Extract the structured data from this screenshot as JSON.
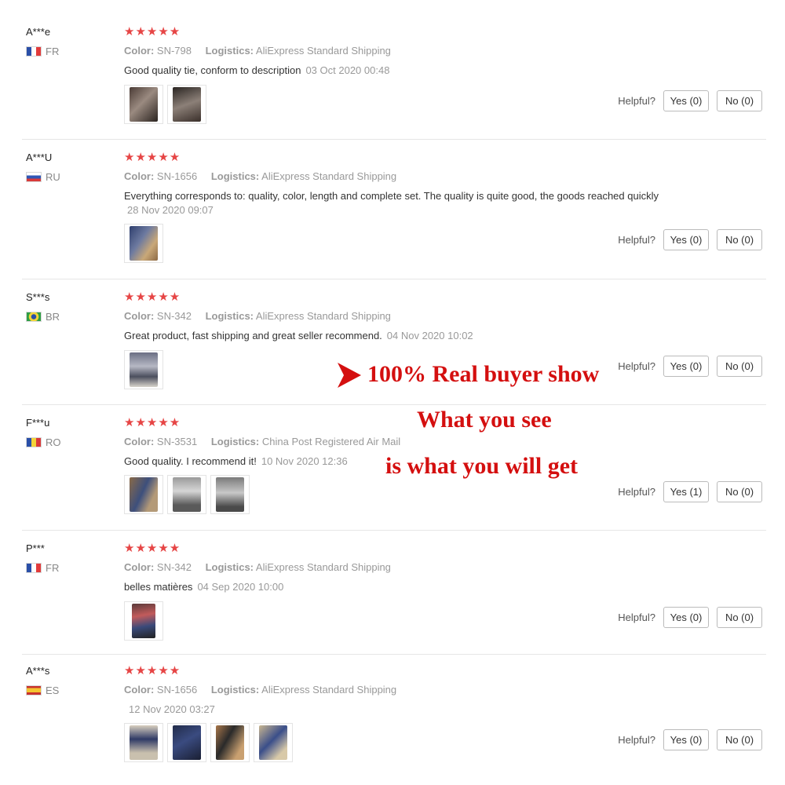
{
  "colors": {
    "star": "#e64545",
    "overlay_red": "#d40f0f",
    "divider": "#e6e6e6"
  },
  "reviews": [
    {
      "name": "A***e",
      "country": "FR",
      "flag": "france-flag-icon",
      "rating": "★★★★★",
      "color_label": "Color:",
      "color_value": "SN-798",
      "logistics_label": "Logistics:",
      "logistics_value": "AliExpress Standard Shipping",
      "text": "Good quality tie, conform to description",
      "date": "03 Oct 2020 00:48",
      "images": 2,
      "helpful_label": "Helpful?",
      "yes_label": "Yes (0)",
      "no_label": "No (0)"
    },
    {
      "name": "A***U",
      "country": "RU",
      "flag": "russia-flag-icon",
      "rating": "★★★★★",
      "color_label": "Color:",
      "color_value": "SN-1656",
      "logistics_label": "Logistics:",
      "logistics_value": "AliExpress Standard Shipping",
      "text": "Everything corresponds to: quality, color, length and complete set. The quality is quite good, the goods reached quickly",
      "date": "28 Nov 2020 09:07",
      "images": 1,
      "helpful_label": "Helpful?",
      "yes_label": "Yes (0)",
      "no_label": "No (0)"
    },
    {
      "name": "S***s",
      "country": "BR",
      "flag": "brazil-flag-icon",
      "rating": "★★★★★",
      "color_label": "Color:",
      "color_value": "SN-342",
      "logistics_label": "Logistics:",
      "logistics_value": "AliExpress Standard Shipping",
      "text": "Great product, fast shipping and great seller recommend.",
      "date": "04 Nov 2020 10:02",
      "images": 1,
      "helpful_label": "Helpful?",
      "yes_label": "Yes (0)",
      "no_label": "No (0)"
    },
    {
      "name": "F***u",
      "country": "RO",
      "flag": "romania-flag-icon",
      "rating": "★★★★★",
      "color_label": "Color:",
      "color_value": "SN-3531",
      "logistics_label": "Logistics:",
      "logistics_value": "China Post Registered Air Mail",
      "text": "Good quality. I recommend it!",
      "date": "10 Nov 2020 12:36",
      "images": 3,
      "helpful_label": "Helpful?",
      "yes_label": "Yes (1)",
      "no_label": "No (0)"
    },
    {
      "name": "P***",
      "country": "FR",
      "flag": "france-flag-icon",
      "rating": "★★★★★",
      "color_label": "Color:",
      "color_value": "SN-342",
      "logistics_label": "Logistics:",
      "logistics_value": "AliExpress Standard Shipping",
      "text": "belles matières",
      "date": "04 Sep 2020 10:00",
      "images": 1,
      "helpful_label": "Helpful?",
      "yes_label": "Yes (0)",
      "no_label": "No (0)"
    },
    {
      "name": "A***s",
      "country": "ES",
      "flag": "spain-flag-icon",
      "rating": "★★★★★",
      "color_label": "Color:",
      "color_value": "SN-1656",
      "logistics_label": "Logistics:",
      "logistics_value": "AliExpress Standard Shipping",
      "text": "",
      "date": "12 Nov 2020 03:27",
      "images": 4,
      "helpful_label": "Helpful?",
      "yes_label": "Yes (0)",
      "no_label": "No (0)"
    }
  ],
  "overlay": {
    "line1": "100% Real buyer show",
    "line2": "What you see",
    "line3": "is what you will get",
    "arrow": "arrow-right-icon"
  }
}
